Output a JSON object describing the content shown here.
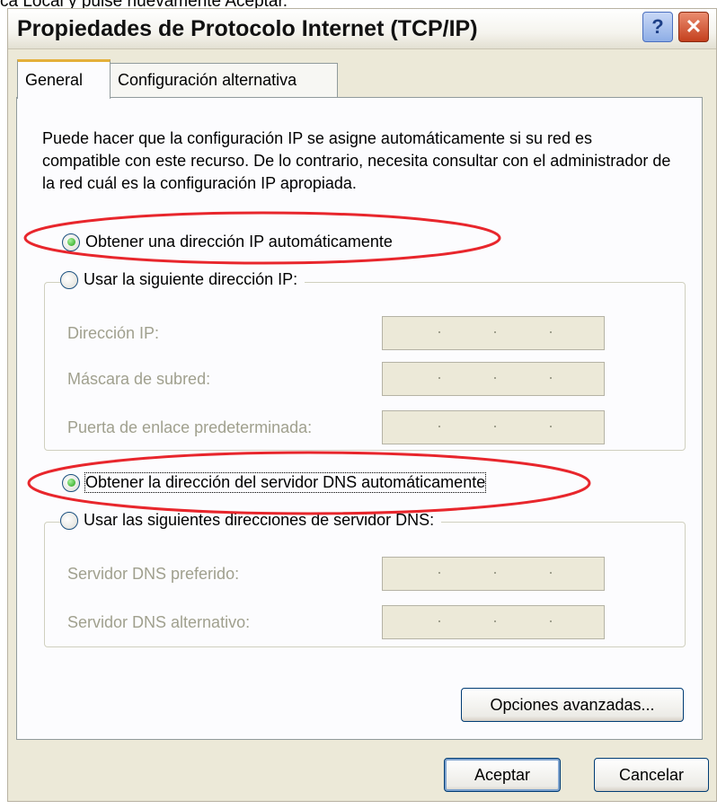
{
  "top_caption": "ca Local y pulse nuevamente Aceptar.",
  "window": {
    "title": "Propiedades de Protocolo Internet (TCP/IP)",
    "help_symbol": "?",
    "close_symbol": "✕"
  },
  "tabs": [
    {
      "label": "General",
      "active": true
    },
    {
      "label": "Configuración alternativa",
      "active": false
    }
  ],
  "description": "Puede hacer que la configuración IP se asigne automáticamente si su red es compatible con este recurso. De lo contrario, necesita consultar con el administrador de la red cuál es la configuración IP apropiada.",
  "ip_section": {
    "auto_radio_label": "Obtener una dirección IP automáticamente",
    "auto_selected": true,
    "manual_radio_label": "Usar la siguiente dirección IP:",
    "manual_selected": false,
    "fields": [
      {
        "label": "Dirección IP:",
        "value": ". . ."
      },
      {
        "label": "Máscara de subred:",
        "value": ". . ."
      },
      {
        "label": "Puerta de enlace predeterminada:",
        "value": ". . ."
      }
    ]
  },
  "dns_section": {
    "auto_radio_label": "Obtener la dirección del servidor DNS automáticamente",
    "auto_selected": true,
    "manual_radio_label": "Usar las siguientes direcciones de servidor DNS:",
    "manual_selected": false,
    "fields": [
      {
        "label": "Servidor DNS preferido:",
        "value": ". . ."
      },
      {
        "label": "Servidor DNS alternativo:",
        "value": ". . ."
      }
    ]
  },
  "buttons": {
    "advanced": "Opciones avanzadas...",
    "ok": "Aceptar",
    "cancel": "Cancelar"
  },
  "colors": {
    "highlight_ellipse": "#e8262c",
    "dialog_bg": "#ece9d8",
    "panel_bg": "#fcfcfe",
    "tab_accent": "#e4b03a",
    "button_border": "#003c74",
    "disabled_text": "#a0a08e"
  },
  "icons": [
    "help-icon",
    "close-icon",
    "radio-selected-icon",
    "radio-unselected-icon"
  ]
}
